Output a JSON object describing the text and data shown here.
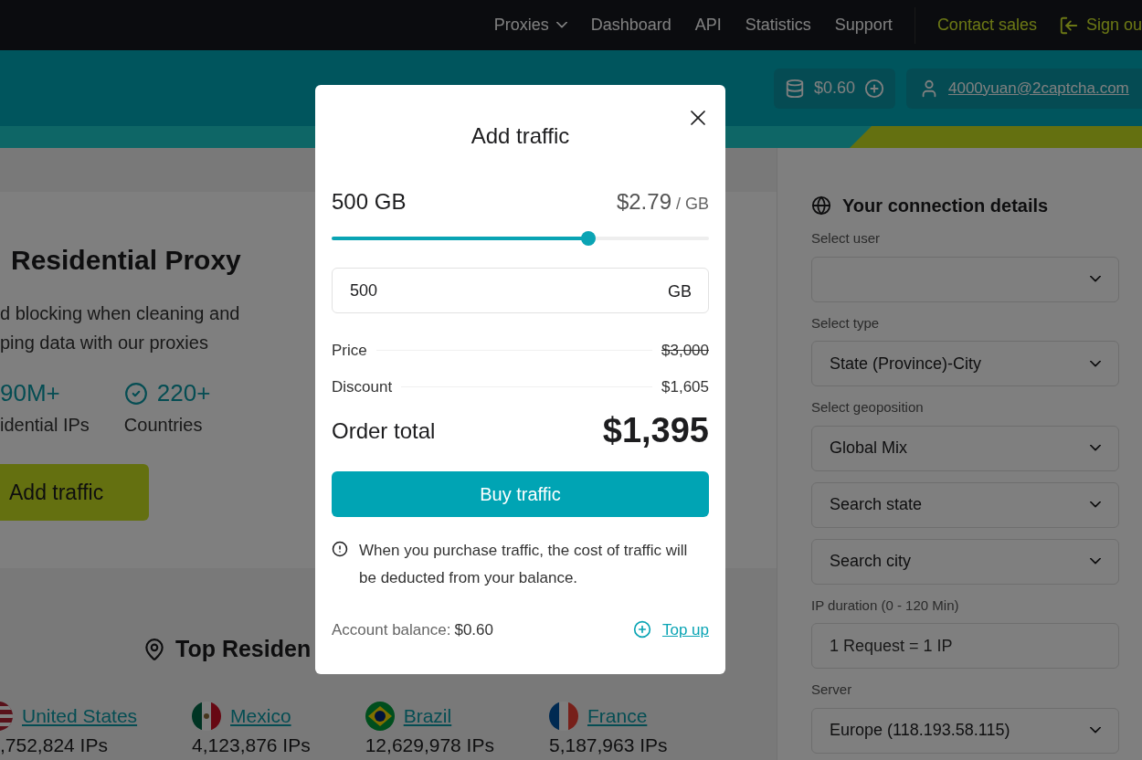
{
  "nav": {
    "items": [
      {
        "label": "Proxies",
        "dropdown": true
      },
      {
        "label": "Dashboard",
        "dropdown": false
      },
      {
        "label": "API",
        "dropdown": false
      },
      {
        "label": "Statistics",
        "dropdown": false
      },
      {
        "label": "Support",
        "dropdown": false
      }
    ],
    "contact": "Contact sales",
    "sign_out": "Sign ou"
  },
  "header": {
    "balance": "$0.60",
    "email": "4000yuan@2captcha.com"
  },
  "hero": {
    "title": "Residential Proxy",
    "description": [
      "d blocking when cleaning and",
      "ping data with our proxies"
    ],
    "stats": [
      {
        "value": "90M+",
        "label": "idential IPs",
        "icon": false
      },
      {
        "value": "220+",
        "label": "Countries",
        "icon": true
      }
    ],
    "button": "Add traffic"
  },
  "top_section": {
    "title": "Top Residen",
    "countries": [
      {
        "name": "United States",
        "ips": ",752,824 IPs",
        "kind": "us"
      },
      {
        "name": "Mexico",
        "ips": "4,123,876 IPs",
        "kind": "mx"
      },
      {
        "name": "Brazil",
        "ips": "12,629,978 IPs",
        "kind": "br"
      },
      {
        "name": "France",
        "ips": "5,187,963 IPs",
        "kind": "fr"
      }
    ]
  },
  "sidebar": {
    "title": "Your connection details",
    "fields": [
      {
        "kind": "select",
        "label": "Select user"
      },
      {
        "kind": "select",
        "label": "Select type",
        "value": "State (Province)-City"
      },
      {
        "kind": "select",
        "label": "Select geoposition",
        "value": "Global Mix"
      },
      {
        "kind": "select",
        "placeholder": "Search state"
      },
      {
        "kind": "select",
        "placeholder": "Search city"
      },
      {
        "kind": "input",
        "label": "IP duration (0 - 120 Min)",
        "placeholder": "1 Request = 1 IP"
      },
      {
        "kind": "select",
        "label": "Server",
        "value": "Europe (118.193.58.115)"
      }
    ]
  },
  "modal": {
    "title": "Add traffic",
    "amount": "500 GB",
    "price": "$2.79",
    "unit": "/ GB",
    "slider": {
      "level": 0.68
    },
    "input": {
      "value": "500",
      "unit": "GB"
    },
    "lines": [
      {
        "label": "Price",
        "value": "$3,000",
        "struck": true
      },
      {
        "label": "Discount",
        "value": "$1,605",
        "struck": false
      }
    ],
    "total_label": "Order total",
    "total": "$1,395",
    "buy": "Buy traffic",
    "notice": "When you purchase traffic, the cost of traffic will be deducted from your balance.",
    "balance_label": "Account balance:",
    "balance": "$0.60",
    "top_up": "Top up"
  }
}
